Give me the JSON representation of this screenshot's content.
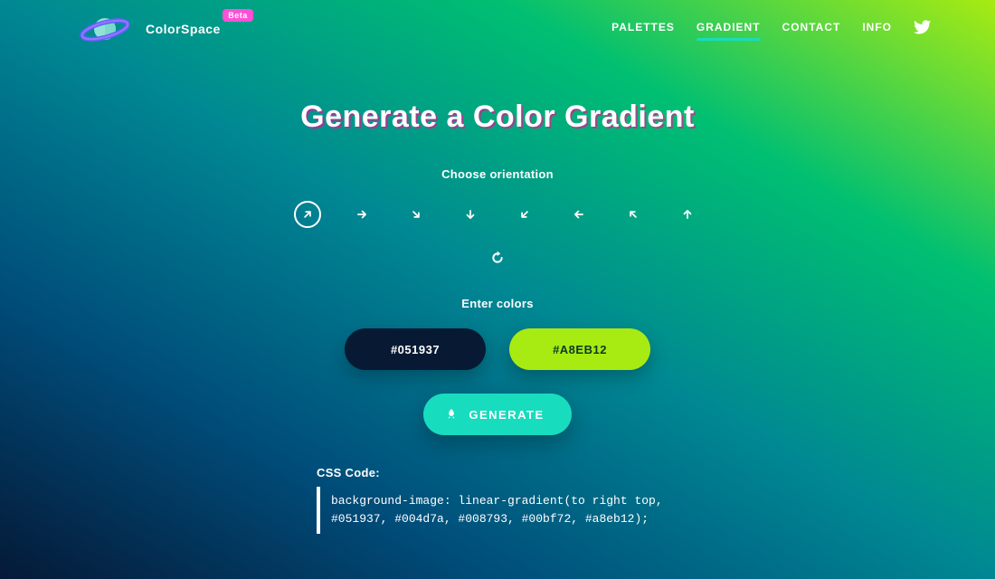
{
  "brand": {
    "name": "ColorSpace",
    "badge": "Beta"
  },
  "nav": {
    "items": [
      {
        "label": "PALETTES",
        "active": false
      },
      {
        "label": "GRADIENT",
        "active": true
      },
      {
        "label": "CONTACT",
        "active": false
      },
      {
        "label": "INFO",
        "active": false
      }
    ],
    "twitter_icon": "twitter"
  },
  "title": "Generate a Color Gradient",
  "orientation": {
    "label": "Choose orientation",
    "selected_index": 0,
    "options": [
      {
        "name": "top-right",
        "icon": "arrow-up-right"
      },
      {
        "name": "right",
        "icon": "arrow-right"
      },
      {
        "name": "bottom-right",
        "icon": "arrow-down-right"
      },
      {
        "name": "bottom",
        "icon": "arrow-down"
      },
      {
        "name": "bottom-left",
        "icon": "arrow-down-left"
      },
      {
        "name": "left",
        "icon": "arrow-left"
      },
      {
        "name": "top-left",
        "icon": "arrow-up-left"
      },
      {
        "name": "top",
        "icon": "arrow-up"
      }
    ],
    "rotate_icon": "rotate"
  },
  "colors": {
    "label": "Enter colors",
    "color1": {
      "value": "#051937",
      "bg": "#081a33",
      "fg": "#ffffff"
    },
    "color2": {
      "value": "#A8EB12",
      "bg": "#a8eb12",
      "fg": "#0a3a24"
    }
  },
  "generate_label": "GENERATE",
  "css_output": {
    "label": "CSS Code:",
    "code": "background-image: linear-gradient(to right top, #051937, #004d7a, #008793, #00bf72, #a8eb12);"
  },
  "gradient_stops": [
    "#051937",
    "#004d7a",
    "#008793",
    "#00bf72",
    "#a8eb12"
  ]
}
